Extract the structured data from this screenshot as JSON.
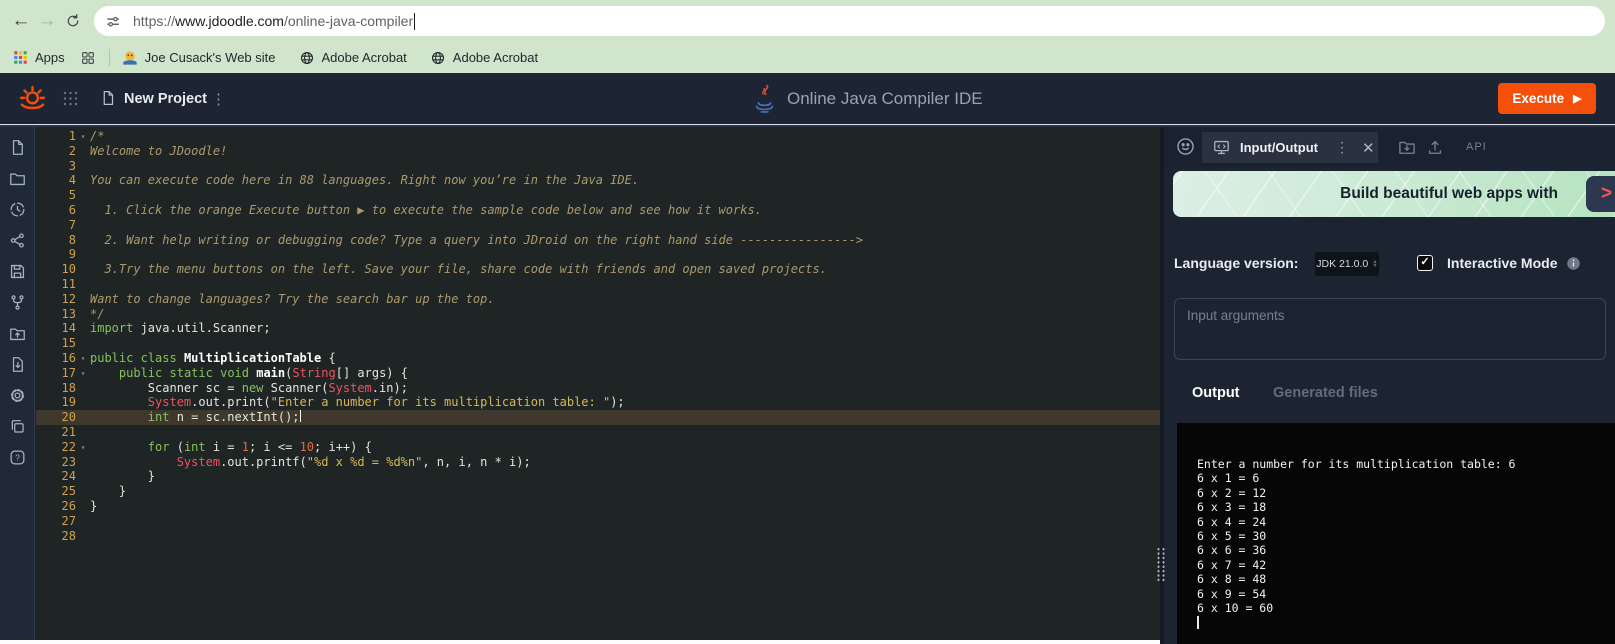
{
  "colors": {
    "accent": "#f4500c",
    "chrome-bg": "#d1e5cd"
  },
  "browser": {
    "url": {
      "scheme": "https://",
      "domain": "www.jdoodle.com",
      "path": "/online-java-compiler"
    },
    "bookmarks_bar": {
      "apps_label": "Apps",
      "items": [
        {
          "icon": "hostgator-favicon",
          "label": "Joe Cusack's Web site"
        },
        {
          "icon": "globe-icon",
          "label": "Adobe Acrobat"
        },
        {
          "icon": "globe-icon",
          "label": "Adobe Acrobat"
        }
      ]
    }
  },
  "app_header": {
    "project_name": "New Project",
    "title": "Online Java Compiler IDE",
    "execute_label": "Execute"
  },
  "sidebar": {
    "items": [
      {
        "id": "file",
        "icon": "file-icon"
      },
      {
        "id": "folder",
        "icon": "folder-icon"
      },
      {
        "id": "history",
        "icon": "history-icon"
      },
      {
        "id": "share",
        "icon": "share-icon"
      },
      {
        "id": "save",
        "icon": "save-icon"
      },
      {
        "id": "fork",
        "icon": "fork-icon"
      },
      {
        "id": "open-project",
        "icon": "folder-upload-icon"
      },
      {
        "id": "download",
        "icon": "file-download-icon"
      },
      {
        "id": "settings",
        "icon": "gear-icon"
      },
      {
        "id": "copy",
        "icon": "copy-icon"
      },
      {
        "id": "help",
        "icon": "help-icon"
      }
    ]
  },
  "editor": {
    "lines": [
      {
        "n": 1,
        "fold": true,
        "tokens": [
          [
            "cm",
            "/*"
          ]
        ]
      },
      {
        "n": 2,
        "tokens": [
          [
            "cm",
            "Welcome to JDoodle!"
          ]
        ]
      },
      {
        "n": 3,
        "tokens": []
      },
      {
        "n": 4,
        "tokens": [
          [
            "cm",
            "You can execute code here in 88 languages. Right now you’re in the Java IDE."
          ]
        ]
      },
      {
        "n": 5,
        "tokens": []
      },
      {
        "n": 6,
        "tokens": [
          [
            "cm",
            "  1. Click the orange Execute button ▶ to execute the sample code below and see how it works."
          ]
        ]
      },
      {
        "n": 7,
        "tokens": []
      },
      {
        "n": 8,
        "tokens": [
          [
            "cm",
            "  2. Want help writing or debugging code? Type a query into JDroid on the right hand side ---------------->"
          ]
        ]
      },
      {
        "n": 9,
        "tokens": []
      },
      {
        "n": 10,
        "tokens": [
          [
            "cm",
            "  3.Try the menu buttons on the left. Save your file, share code with friends and open saved projects."
          ]
        ]
      },
      {
        "n": 11,
        "tokens": []
      },
      {
        "n": 12,
        "tokens": [
          [
            "cm",
            "Want to change languages? Try the search bar up the top."
          ]
        ]
      },
      {
        "n": 13,
        "tokens": [
          [
            "cm",
            "*/"
          ]
        ]
      },
      {
        "n": 14,
        "tokens": [
          [
            "kw",
            "import"
          ],
          [
            "pl",
            " java.util.Scanner;"
          ]
        ]
      },
      {
        "n": 15,
        "tokens": []
      },
      {
        "n": 16,
        "fold": true,
        "tokens": [
          [
            "kw",
            "public"
          ],
          [
            "pl",
            " "
          ],
          [
            "kw",
            "class"
          ],
          [
            "pl",
            " "
          ],
          [
            "fn",
            "MultiplicationTable"
          ],
          [
            "pl",
            " {"
          ]
        ]
      },
      {
        "n": 17,
        "fold": true,
        "tokens": [
          [
            "pl",
            "    "
          ],
          [
            "kw",
            "public"
          ],
          [
            "pl",
            " "
          ],
          [
            "kw",
            "static"
          ],
          [
            "pl",
            " "
          ],
          [
            "kw",
            "void"
          ],
          [
            "pl",
            " "
          ],
          [
            "fn",
            "main"
          ],
          [
            "pl",
            "("
          ],
          [
            "tp",
            "String"
          ],
          [
            "pl",
            "[] args) {"
          ]
        ]
      },
      {
        "n": 18,
        "tokens": [
          [
            "pl",
            "        Scanner sc = "
          ],
          [
            "kw",
            "new"
          ],
          [
            "pl",
            " Scanner("
          ],
          [
            "tp",
            "System"
          ],
          [
            "pl",
            ".in);"
          ]
        ]
      },
      {
        "n": 19,
        "tokens": [
          [
            "pl",
            "        "
          ],
          [
            "tp",
            "System"
          ],
          [
            "pl",
            ".out.print("
          ],
          [
            "st",
            "\"Enter a number for its multiplication table: \""
          ],
          [
            "pl",
            ");"
          ]
        ]
      },
      {
        "n": 20,
        "active": true,
        "cursor": true,
        "tokens": [
          [
            "pl",
            "        "
          ],
          [
            "kw",
            "int"
          ],
          [
            "pl",
            " n = sc.nextInt();"
          ]
        ]
      },
      {
        "n": 21,
        "tokens": []
      },
      {
        "n": 22,
        "fold": true,
        "tokens": [
          [
            "pl",
            "        "
          ],
          [
            "kw",
            "for"
          ],
          [
            "pl",
            " ("
          ],
          [
            "kw",
            "int"
          ],
          [
            "pl",
            " i = "
          ],
          [
            "nm",
            "1"
          ],
          [
            "pl",
            "; i <= "
          ],
          [
            "nm",
            "10"
          ],
          [
            "pl",
            "; i++) {"
          ]
        ]
      },
      {
        "n": 23,
        "tokens": [
          [
            "pl",
            "            "
          ],
          [
            "tp",
            "System"
          ],
          [
            "pl",
            ".out.printf("
          ],
          [
            "st",
            "\"%d x %d = %d%n\""
          ],
          [
            "pl",
            ", n, i, n * i);"
          ]
        ]
      },
      {
        "n": 24,
        "tokens": [
          [
            "pl",
            "        }"
          ]
        ]
      },
      {
        "n": 25,
        "tokens": [
          [
            "pl",
            "    }"
          ]
        ]
      },
      {
        "n": 26,
        "tokens": [
          [
            "pl",
            "}"
          ]
        ]
      },
      {
        "n": 27,
        "tokens": []
      },
      {
        "n": 28,
        "tokens": []
      }
    ]
  },
  "panel": {
    "io_tab_label": "Input/Output",
    "api_label": "API",
    "banner_text": "Build beautiful web apps with",
    "banner_logo_glyph": ">",
    "language_label": "Language version:",
    "language_value": "JDK 21.0.0",
    "interactive_label": "Interactive Mode",
    "interactive_checked": true,
    "input_placeholder": "Input arguments",
    "tabs": [
      {
        "label": "Output",
        "active": true
      },
      {
        "label": "Generated files",
        "active": false
      }
    ],
    "terminal_lines": [
      "Enter a number for its multiplication table: 6",
      "6 x 1 = 6",
      "6 x 2 = 12",
      "6 x 3 = 18",
      "6 x 4 = 24",
      "6 x 5 = 30",
      "6 x 6 = 36",
      "6 x 7 = 42",
      "6 x 8 = 48",
      "6 x 9 = 54",
      "6 x 10 = 60"
    ]
  }
}
